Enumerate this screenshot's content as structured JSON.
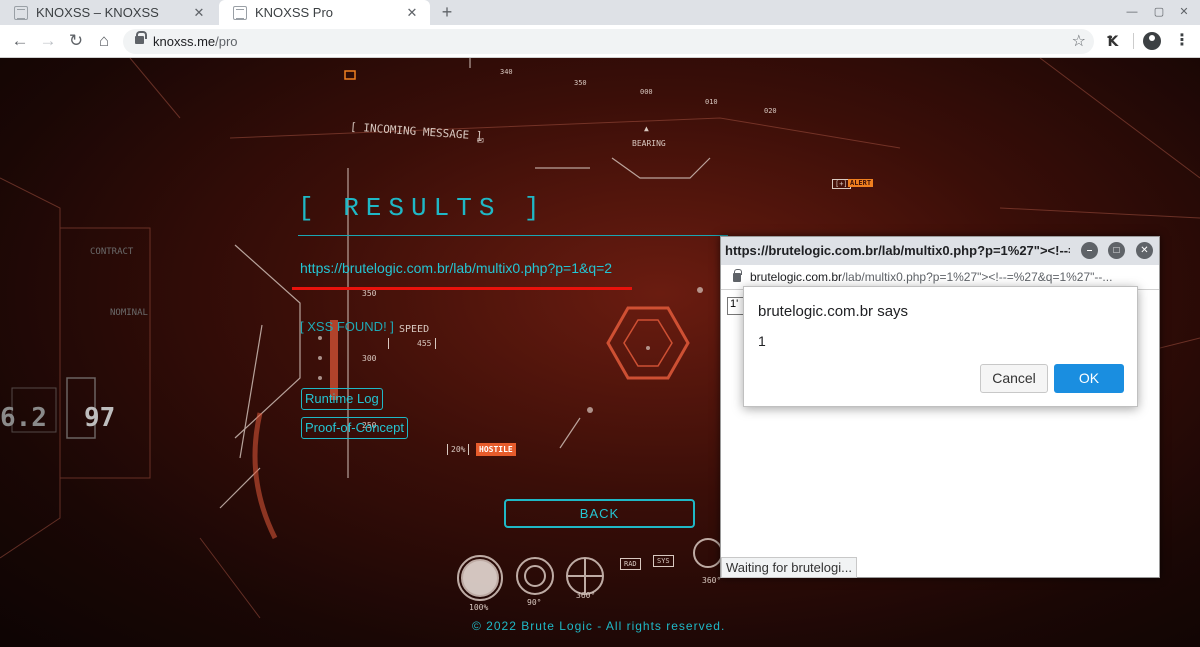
{
  "browser": {
    "tabs": [
      {
        "label": "KNOXSS – KNOXSS",
        "active": false
      },
      {
        "label": "KNOXSS Pro",
        "active": true
      }
    ],
    "url_host": "knoxss.me",
    "url_path": "/pro"
  },
  "page": {
    "results_title": "[ RESULTS ]",
    "target_url": "https://brutelogic.com.br/lab/multix0.php?p=1&q=2",
    "xss_found": "[ XSS FOUND! ]",
    "runtime_log": "Runtime Log",
    "proof_of_concept": "Proof-of-Concept",
    "back": "BACK",
    "copyright": "© 2022 Brute Logic - All rights reserved.",
    "accent_color": "#1fb8c6",
    "annotation_color": "#e8120c"
  },
  "hud": {
    "incoming_message": "[ INCOMING MESSAGE ]",
    "bearing": "BEARING",
    "alert": "ALERT",
    "speed": "SPEED",
    "speed_value": "455",
    "scale_350": "350",
    "scale_300": "300",
    "scale_250": "250",
    "hostile": "HOSTILE",
    "hostile_pct": "20%",
    "rad": "RAD",
    "sys": "SYS",
    "contract": "CONTRACT",
    "nominal": "NOMINAL",
    "big_left": "6.2",
    "big_right": "97",
    "compass_340": "340",
    "compass_350": "350",
    "compass_000": "000",
    "compass_010": "010",
    "compass_020": "020",
    "dial_100": "100%",
    "dial_90": "90°",
    "dial_360a": "360°",
    "dial_360b": "360°"
  },
  "popup": {
    "title": "https://brutelogic.com.br/lab/multix0.php?p=1%27\"><!--=...",
    "url_host": "brutelogic.com.br",
    "url_path": "/lab/multix0.php?p=1%27\"><!--=%27&q=1%27\"--...",
    "input_value": "1'",
    "status": "Waiting for brutelogi..."
  },
  "dialog": {
    "title": "brutelogic.com.br says",
    "message": "1",
    "cancel": "Cancel",
    "ok": "OK"
  }
}
